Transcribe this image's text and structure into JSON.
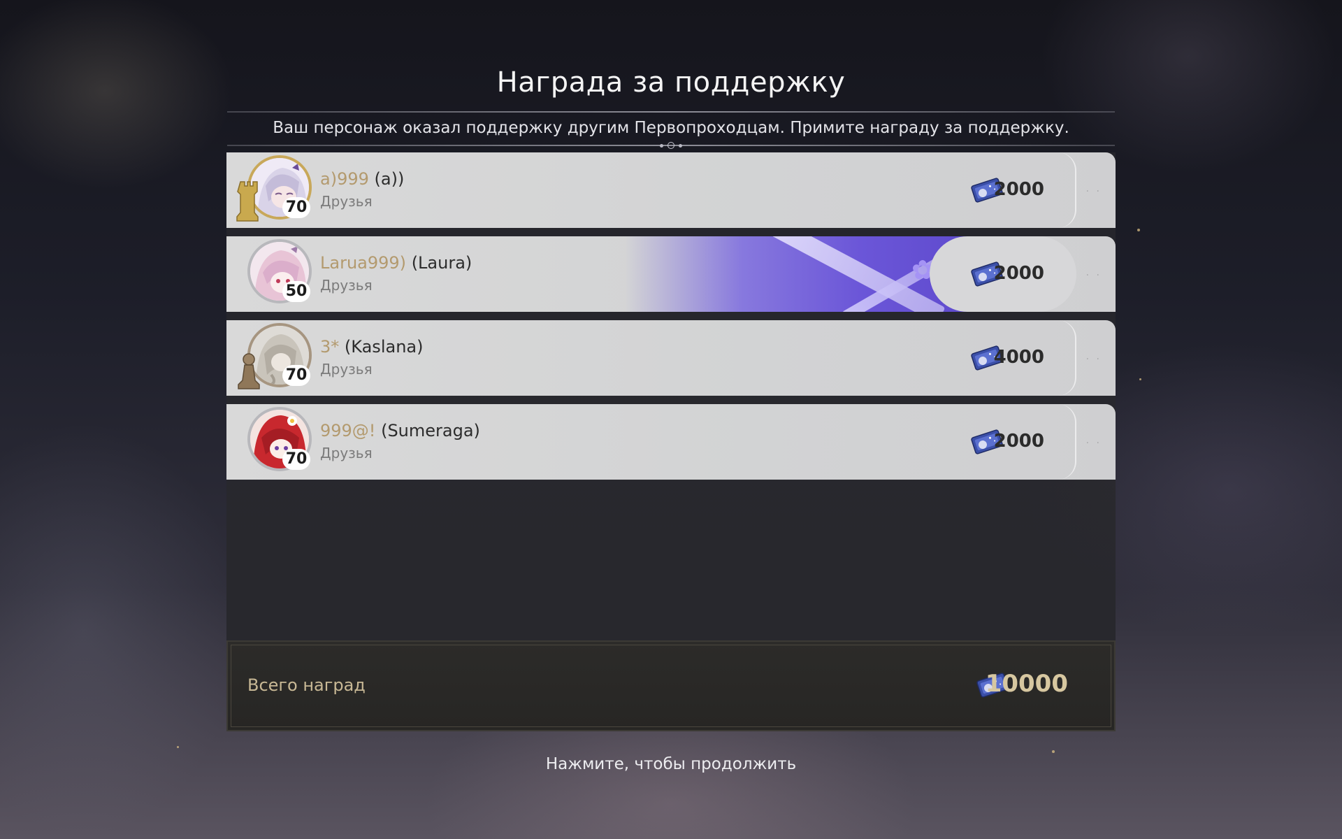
{
  "header": {
    "title": "Награда за поддержку",
    "subtitle": "Ваш персонаж оказал поддержку другим Первопроходцам. Примите награду за поддержку."
  },
  "rows": [
    {
      "nickname": "a)999",
      "name": "(a))",
      "relation": "Друзья",
      "level": "70",
      "reward": "2000",
      "avatar": "white-haired-girl-avatar",
      "badge": "gold-rook-icon"
    },
    {
      "nickname": "Larua999)",
      "name": "(Laura)",
      "relation": "Друзья",
      "level": "50",
      "reward": "2000",
      "avatar": "pink-haired-girl-avatar",
      "badge": "none"
    },
    {
      "nickname": "3*",
      "name": "(Kaslana)",
      "relation": "Друзья",
      "level": "70",
      "reward": "4000",
      "avatar": "grey-haired-avatar",
      "badge": "bronze-pawn-icon"
    },
    {
      "nickname": "999@!",
      "name": "(Sumeraga)",
      "relation": "Друзья",
      "level": "70",
      "reward": "2000",
      "avatar": "red-haired-girl-avatar",
      "badge": "none"
    }
  ],
  "total": {
    "label": "Всего наград",
    "value": "10000",
    "icon": "star-rail-pass-icon"
  },
  "footer": {
    "continue_text": "Нажмите, чтобы продолжить"
  },
  "colors": {
    "nickname": "#b39a6e",
    "highlight": "#6b56d8",
    "total_text": "#d7c7a0"
  }
}
